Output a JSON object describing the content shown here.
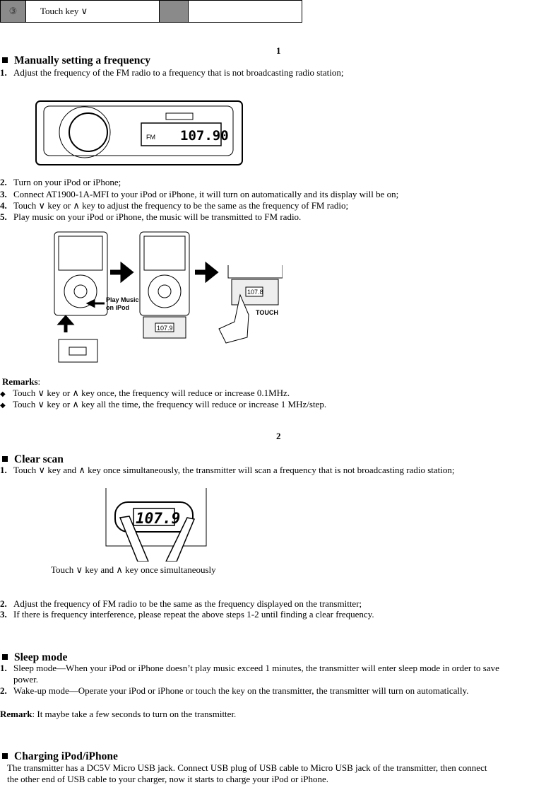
{
  "top_table": {
    "step": "③",
    "label": "Touch key ∨"
  },
  "page1": {
    "number": "1",
    "heading": "Manually setting a frequency",
    "steps": [
      {
        "n": "1.",
        "text": "Adjust the frequency of the FM radio to a frequency that is not broadcasting radio station;"
      },
      {
        "n": "2.",
        "text": "Turn on your iPod or iPhone;"
      },
      {
        "n": "3.",
        "text": "Connect AT1900-1A-MFI to your iPod or iPhone, it will turn on automatically and its display will be on;"
      },
      {
        "n": "4.",
        "text": "Touch ∨ key or ∧ key to adjust the frequency to be the same as the frequency of FM radio;"
      },
      {
        "n": "5.",
        "text": "Play music on your iPod or iPhone, the music will be transmitted to FM radio."
      }
    ],
    "radio_band": "FM",
    "radio_freq": "107.90",
    "figure_labels": {
      "play": "Play Music",
      "on": "on iPod",
      "touch": "TOUCH",
      "freq1": "107.9",
      "freq2": "107.8"
    },
    "remarks_label": "Remarks",
    "remarks": [
      "Touch ∨ key or ∧ key once, the frequency will reduce or increase 0.1MHz.",
      "Touch ∨ key or ∧ key all the time, the frequency will reduce or increase 1 MHz/step."
    ]
  },
  "page2": {
    "number": "2",
    "clear": {
      "heading": "Clear scan",
      "steps": [
        {
          "n": "1.",
          "text": "Touch ∨ key and ∧ key once simultaneously, the transmitter will scan a frequency that is not broadcasting radio station;"
        },
        {
          "n": "2.",
          "text": "Adjust the frequency of FM radio to be the same as the frequency displayed on the transmitter;"
        },
        {
          "n": "3.",
          "text": "If there is frequency interference, please repeat the above steps 1-2 until finding a clear frequency."
        }
      ],
      "display": "107.9",
      "caption": "Touch ∨ key and ∧ key once simultaneously"
    },
    "sleep": {
      "heading": "Sleep mode",
      "steps": [
        {
          "n": "1.",
          "text": "Sleep mode—When your iPod or iPhone doesn’t play music exceed 1 minutes, the transmitter will enter sleep mode in order to save",
          "cont": "power."
        },
        {
          "n": "2.",
          "text": "Wake-up mode—Operate your iPod or iPhone or touch the key on the transmitter, the transmitter will turn on automatically."
        }
      ],
      "remark_label": "Remark",
      "remark": ": It maybe take a few seconds to turn on the transmitter."
    },
    "charging": {
      "heading": "Charging iPod/iPhone",
      "lines": [
        "The transmitter has a DC5V Micro USB jack. Connect USB plug of USB cable to Micro USB jack of the transmitter, then connect",
        "the other end of USB cable to your charger, now it starts to charge your iPod or iPhone."
      ]
    }
  }
}
